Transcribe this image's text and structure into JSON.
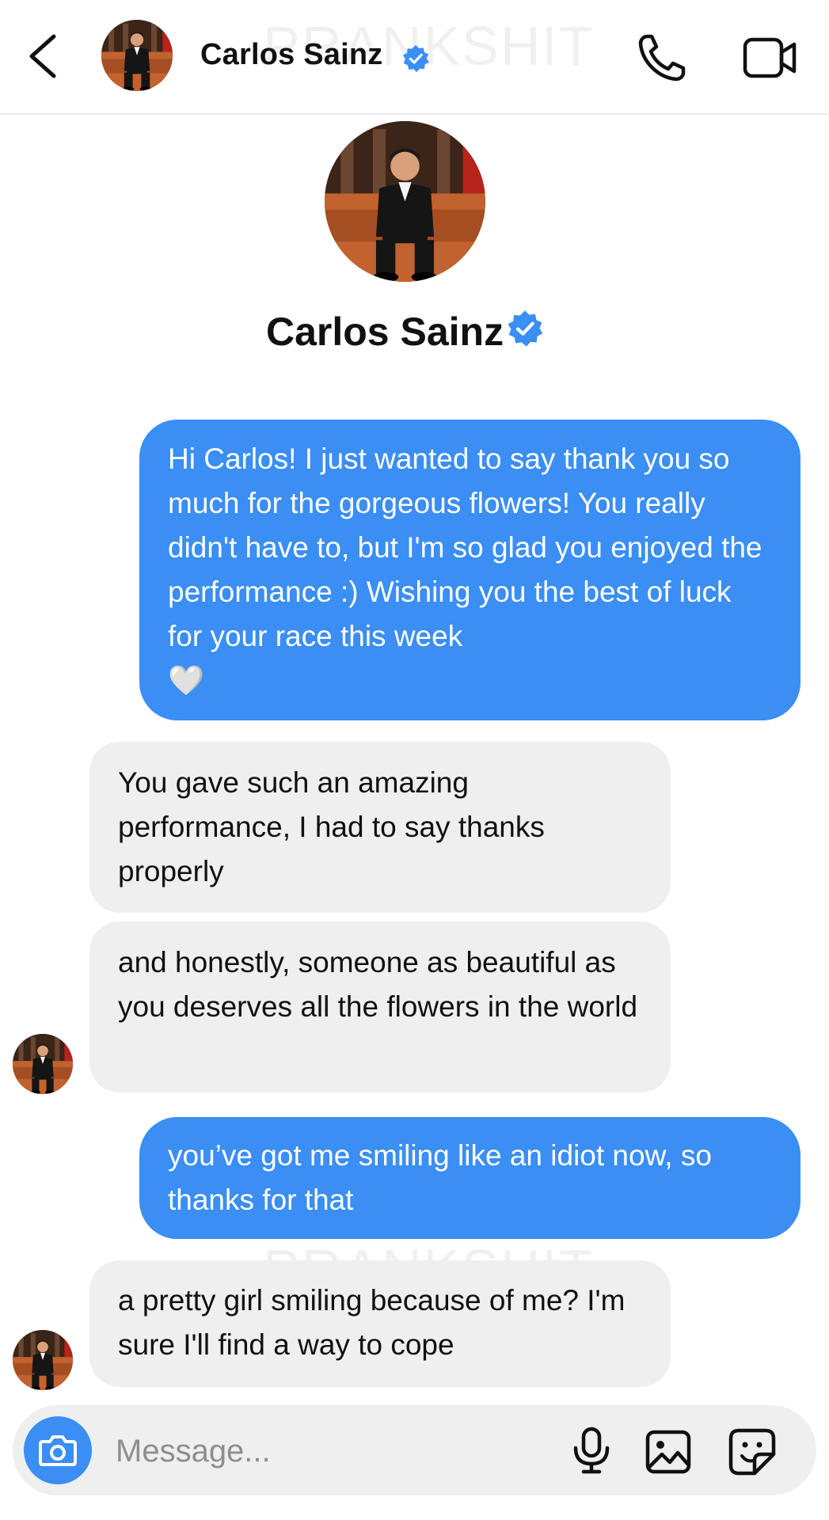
{
  "header": {
    "name": "Carlos Sainz",
    "icons": {
      "back": "chevron-left-icon",
      "call": "phone-icon",
      "video": "video-camera-icon",
      "verified": "verified-badge-icon"
    }
  },
  "profile": {
    "name": "Carlos Sainz"
  },
  "watermark": "PRANKSHIT",
  "messages": [
    {
      "direction": "outgoing",
      "text": "Hi Carlos! I just wanted to say thank you so much for the gorgeous flowers! You really didn't have to, but I'm so glad you enjoyed the performance :) Wishing you the best of luck for your race this week",
      "emoji": "🤍"
    },
    {
      "direction": "incoming",
      "text": "You gave such an amazing performance, I had to say thanks properly"
    },
    {
      "direction": "incoming",
      "text": "and honestly, someone as beautiful as you deserves all the flowers in the world"
    },
    {
      "direction": "outgoing",
      "text": "you’ve got me smiling like an idiot now, so thanks for that"
    },
    {
      "direction": "incoming",
      "text": "a pretty girl smiling because of me? I'm sure I'll find a way to cope"
    }
  ],
  "composer": {
    "placeholder": "Message...",
    "icons": {
      "camera": "camera-icon",
      "mic": "microphone-icon",
      "gallery": "image-icon",
      "sticker": "sticker-icon"
    }
  },
  "colors": {
    "outgoing_bubble": "#3a8ef4",
    "incoming_bubble": "#efefef",
    "verified": "#3a8ef4"
  }
}
